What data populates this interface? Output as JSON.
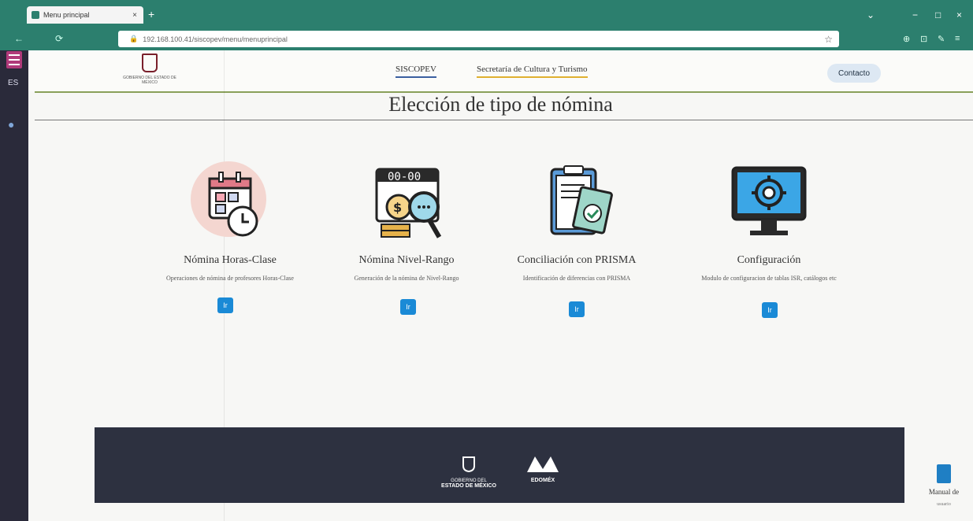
{
  "browser": {
    "tab_title": "Menu principal",
    "tab_close": "×",
    "new_tab": "+",
    "url": "192.168.100.41/siscopev/menu/menuprincipal",
    "back": "←",
    "reload": "⟳",
    "lock_icon": "🔒",
    "star": "☆",
    "minimize": "−",
    "maximize": "□",
    "close": "×",
    "dropdown": "⌄",
    "extensions": [
      "⊕",
      "⊡",
      "✎",
      "≡"
    ]
  },
  "rail": {
    "item1": "ES",
    "item2": "●"
  },
  "header": {
    "logo_text": "GOBIERNO DEL ESTADO DE MÉXICO",
    "nav1": "SISCOPEV",
    "nav2": "Secretaría de Cultura y Turismo",
    "contact": "Contacto"
  },
  "page": {
    "title": "Elección de tipo de nómina"
  },
  "cards": [
    {
      "name": "Nómina Horas-Clase",
      "desc": "Operaciones de nómina de profesores Horas-Clase",
      "button": "Ir",
      "icon": "calendar-clock-icon"
    },
    {
      "name": "Nómina Nivel-Rango",
      "desc": "Generación de la nómina de Nivel-Rango",
      "button": "Ir",
      "icon": "money-search-icon"
    },
    {
      "name": "Conciliación con PRISMA",
      "desc": "Identificación de diferencias con PRISMA",
      "button": "Ir",
      "icon": "clipboard-check-icon"
    },
    {
      "name": "Configuración",
      "desc": "Modulo de configuracion de tablas ISR, catálogos etc",
      "button": "Ir",
      "icon": "monitor-gear-icon"
    }
  ],
  "footer": {
    "gov_line1": "GOBIERNO DEL",
    "gov_line2": "ESTADO DE MÉXICO",
    "edomex": "EDOMÉX"
  },
  "manual": {
    "label": "Manual de",
    "sub": "usuario"
  },
  "colors": {
    "browser": "#2c7f6e",
    "button": "#1a8ad6",
    "footer": "#2d3140",
    "accent": "#8aa05a"
  }
}
